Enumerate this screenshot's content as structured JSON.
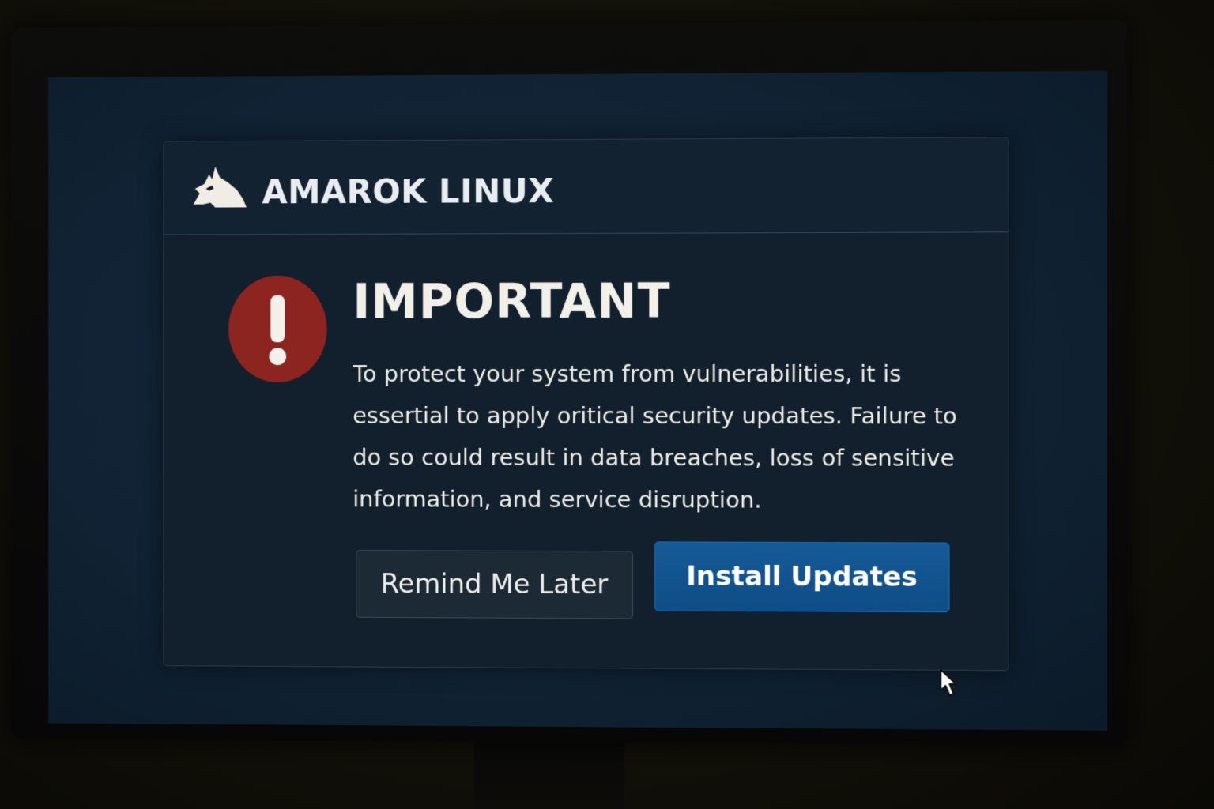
{
  "app": {
    "brand_name": "AMAROK LINUX",
    "brand_icon": "wolf-logo-icon"
  },
  "dialog": {
    "icon": "exclamation-circle-icon",
    "title": "IMPORTANT",
    "message": "To protect your system from vulnerabilities, it is essertial to apply oritical security updates. Failure to do so could result in data breaches, loss of sensitive information, and service disruption.",
    "buttons": {
      "remind_later": "Remind Me Later",
      "install": "Install Updates"
    }
  },
  "colors": {
    "screen_background": "#102233",
    "dialog_background": "#12202e",
    "warning_red": "#8c2420",
    "primary_button": "#0f4d86",
    "secondary_button": "#1c2a36",
    "text": "#eeece6"
  },
  "cursor_icon": "mouse-pointer-icon"
}
